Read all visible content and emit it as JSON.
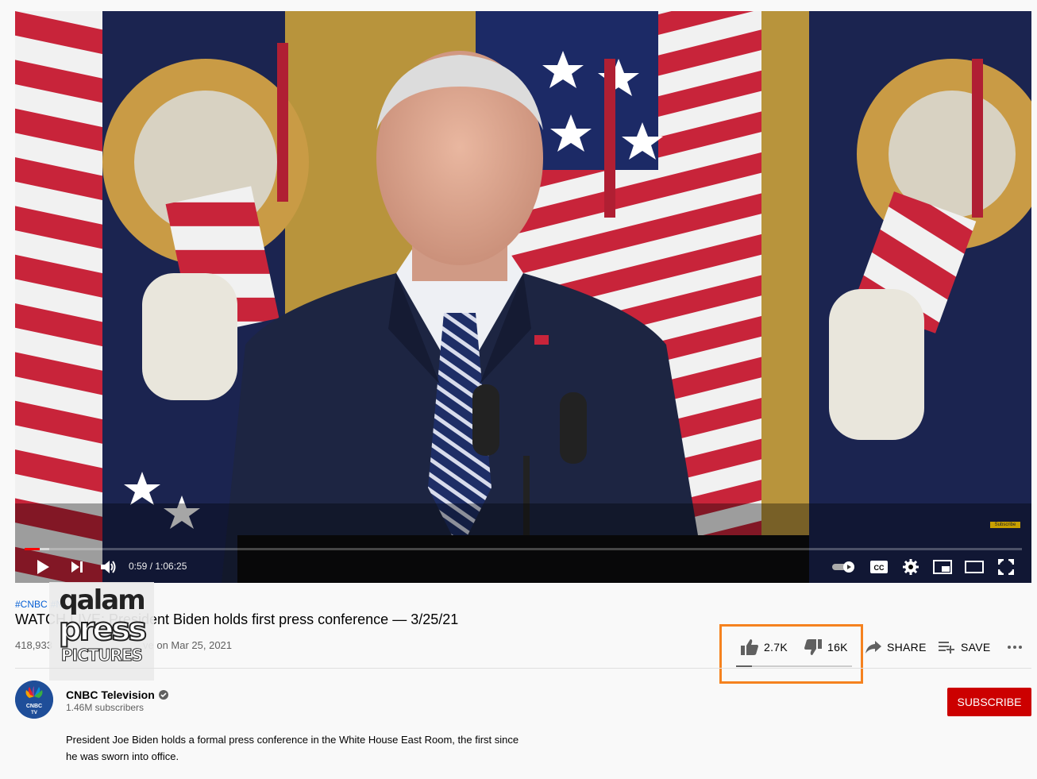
{
  "player": {
    "time_display": "0:59 / 1:06:25",
    "progress_fraction": 0.015,
    "corner_badge": "Subscribe",
    "icons": [
      "play-icon",
      "next-icon",
      "volume-icon",
      "autoplay-toggle-icon",
      "cc-icon",
      "settings-icon",
      "miniplayer-icon",
      "theater-icon",
      "fullscreen-icon"
    ]
  },
  "video": {
    "hashtags": [
      "#CNBC",
      "#N"
    ],
    "title": "WATCH LIVE: President Biden holds first press conference — 3/25/21",
    "views": "418,933",
    "date": "ve on Mar 25, 2021"
  },
  "watermark": {
    "line1": "qalam",
    "line2": "press",
    "line3": "PICTURES"
  },
  "actions": {
    "likes": "2.7K",
    "dislikes": "16K",
    "share": "SHARE",
    "save": "SAVE",
    "like_ratio": 0.14
  },
  "channel": {
    "name": "CNBC Television",
    "subscribers": "1.46M subscribers",
    "avatar_text_1": "CNBC",
    "avatar_text_2": "TV",
    "subscribe_label": "SUBSCRIBE"
  },
  "description": {
    "line1": "President Joe Biden holds a formal press conference in the White House East Room, the first since",
    "line2": "he was sworn into office."
  },
  "colors": {
    "accent_red": "#cc0000",
    "link_blue": "#065fd4",
    "highlight_orange": "#f5821f"
  }
}
